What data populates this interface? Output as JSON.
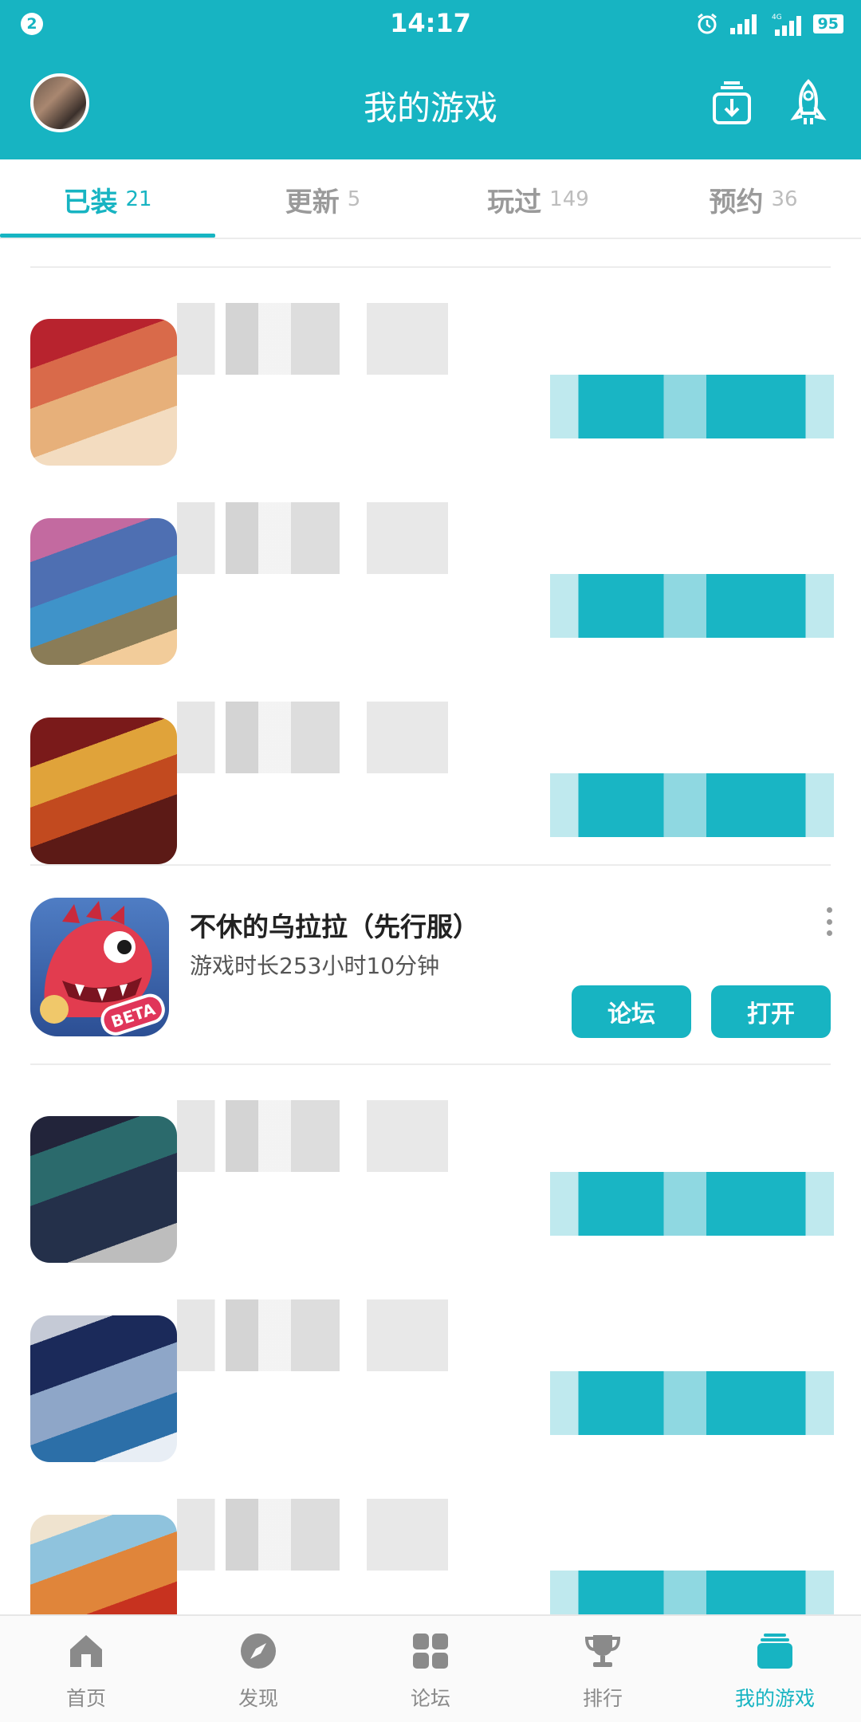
{
  "status_bar": {
    "notification_count": "2",
    "time": "14:17",
    "battery": "95",
    "network_label": "4G",
    "icons": [
      "alarm-icon",
      "signal-icon",
      "signal-4g-icon",
      "battery-icon"
    ]
  },
  "header": {
    "title": "我的游戏",
    "icons": [
      "download-manager-icon",
      "rocket-icon"
    ]
  },
  "tabs": [
    {
      "label": "已装",
      "count": "21"
    },
    {
      "label": "更新",
      "count": "5"
    },
    {
      "label": "玩过",
      "count": "149"
    },
    {
      "label": "预约",
      "count": "36"
    }
  ],
  "featured_game": {
    "name": "不休的乌拉拉（先行服）",
    "playtime": "游戏时长253小时10分钟",
    "badge": "BETA",
    "forum_button": "论坛",
    "open_button": "打开"
  },
  "bottom_nav": [
    {
      "label": "首页",
      "icon": "home-icon"
    },
    {
      "label": "发现",
      "icon": "compass-icon"
    },
    {
      "label": "论坛",
      "icon": "grid-icon"
    },
    {
      "label": "排行",
      "icon": "trophy-icon"
    },
    {
      "label": "我的游戏",
      "icon": "stack-icon"
    }
  ],
  "colors": {
    "accent": "#17b4c2",
    "text_primary": "#222222",
    "text_secondary": "#555555",
    "inactive": "#9a9a9a"
  }
}
